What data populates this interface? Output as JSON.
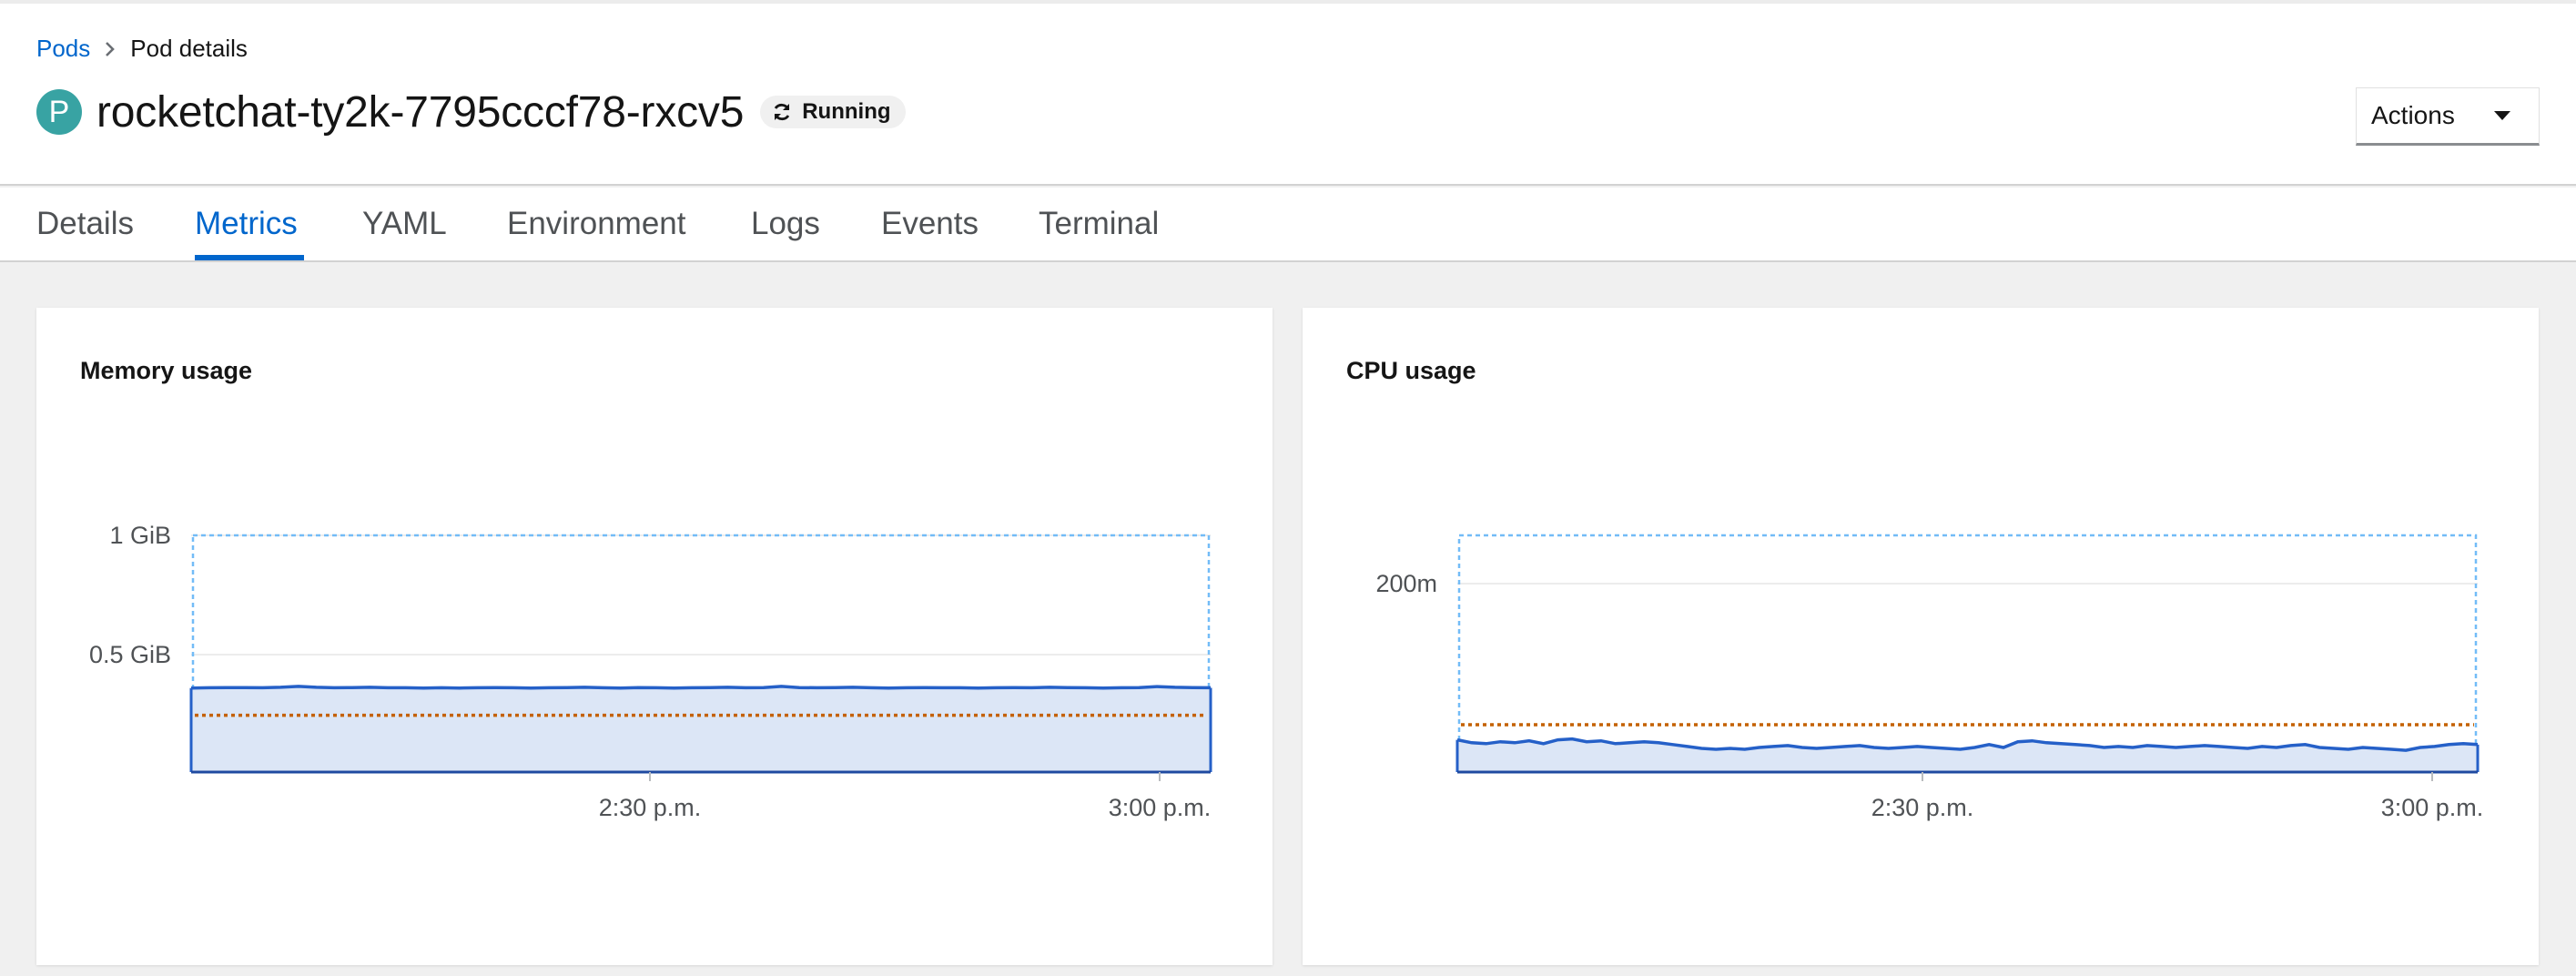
{
  "breadcrumb": {
    "parent": "Pods",
    "current": "Pod details"
  },
  "resource": {
    "badge": "P",
    "name": "rocketchat-ty2k-7795cccf78-rxcv5",
    "status": "Running"
  },
  "actions": {
    "label": "Actions"
  },
  "tabs": [
    "Details",
    "Metrics",
    "YAML",
    "Environment",
    "Logs",
    "Events",
    "Terminal"
  ],
  "active_tab": "Metrics",
  "colors": {
    "link": "#0066cc",
    "series": "#2560c8",
    "area": "#dce6f6",
    "request": "#c46100",
    "limit": "#73bcf7",
    "badge": "#38a3a3"
  },
  "chart_data": [
    {
      "type": "area",
      "title": "Memory usage",
      "yticks": [
        "1 GiB",
        "0.5 GiB"
      ],
      "xticks": [
        "2:30 p.m.",
        "3:00 p.m."
      ],
      "ylim": [
        0,
        1
      ],
      "limit": 1.0,
      "request": 0.24,
      "values": [
        0.355,
        0.356,
        0.357,
        0.357,
        0.356,
        0.358,
        0.362,
        0.358,
        0.356,
        0.357,
        0.358,
        0.356,
        0.356,
        0.355,
        0.356,
        0.355,
        0.356,
        0.357,
        0.356,
        0.355,
        0.356,
        0.357,
        0.358,
        0.356,
        0.355,
        0.357,
        0.356,
        0.355,
        0.356,
        0.357,
        0.358,
        0.356,
        0.357,
        0.362,
        0.357,
        0.356,
        0.357,
        0.358,
        0.356,
        0.355,
        0.356,
        0.357,
        0.356,
        0.356,
        0.355,
        0.356,
        0.357,
        0.356,
        0.358,
        0.357,
        0.356,
        0.355,
        0.356,
        0.357,
        0.361,
        0.358,
        0.357,
        0.356
      ]
    },
    {
      "type": "area",
      "title": "CPU usage",
      "yticks": [
        "200m"
      ],
      "xticks": [
        "2:30 p.m.",
        "3:00 p.m."
      ],
      "ylim": [
        0,
        250
      ],
      "limit": 250,
      "request": 50,
      "values": [
        34,
        31,
        30,
        32,
        31,
        33,
        30,
        34,
        35,
        32,
        33,
        30,
        31,
        32,
        31,
        29,
        27,
        25,
        24,
        25,
        24,
        26,
        27,
        28,
        26,
        25,
        26,
        27,
        28,
        26,
        25,
        26,
        27,
        26,
        25,
        24,
        26,
        29,
        26,
        32,
        33,
        31,
        30,
        29,
        28,
        26,
        27,
        26,
        28,
        27,
        26,
        27,
        28,
        27,
        26,
        25,
        27,
        26,
        28,
        29,
        26,
        25,
        24,
        26,
        25,
        24,
        23,
        26,
        27,
        29,
        30,
        29
      ]
    }
  ]
}
